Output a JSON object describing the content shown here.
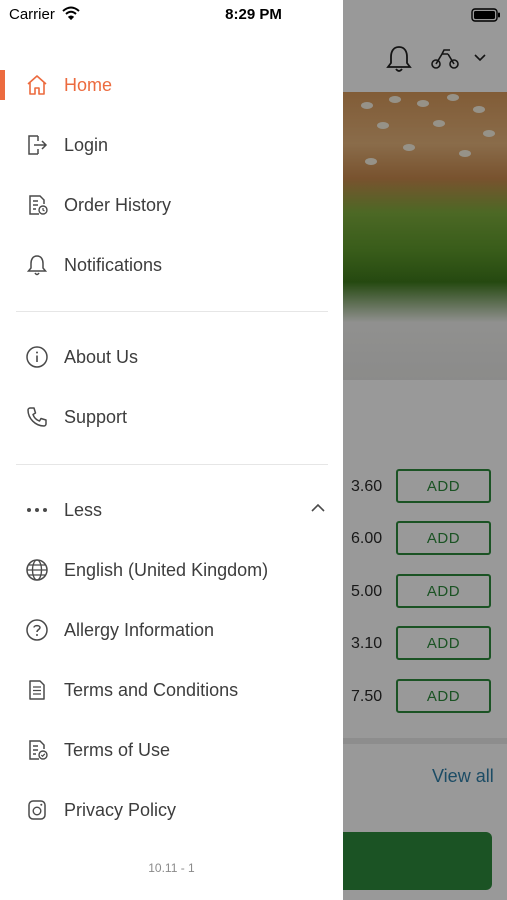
{
  "status_bar": {
    "carrier": "Carrier",
    "time": "8:29 PM"
  },
  "drawer": {
    "items": [
      {
        "label": "Home",
        "icon": "home-icon",
        "active": true
      },
      {
        "label": "Login",
        "icon": "login-icon"
      },
      {
        "label": "Order History",
        "icon": "order-history-icon"
      },
      {
        "label": "Notifications",
        "icon": "bell-icon"
      }
    ],
    "secondary": [
      {
        "label": "About Us",
        "icon": "info-icon"
      },
      {
        "label": "Support",
        "icon": "phone-icon"
      }
    ],
    "less_label": "Less",
    "extra": [
      {
        "label": "English (United Kingdom)",
        "icon": "globe-icon"
      },
      {
        "label": "Allergy Information",
        "icon": "question-icon"
      },
      {
        "label": "Terms and Conditions",
        "icon": "document-icon"
      },
      {
        "label": "Terms of Use",
        "icon": "terms-check-icon"
      },
      {
        "label": "Privacy Policy",
        "icon": "privacy-icon"
      }
    ],
    "version": "10.11 - 1"
  },
  "background": {
    "prices": [
      "3.60",
      "6.00",
      "5.00",
      "3.10",
      "7.50"
    ],
    "add_label": "ADD",
    "view_all": "View all"
  },
  "colors": {
    "accent": "#ec6b3f",
    "green": "#2e8b3d",
    "link": "#2f7fa8"
  }
}
